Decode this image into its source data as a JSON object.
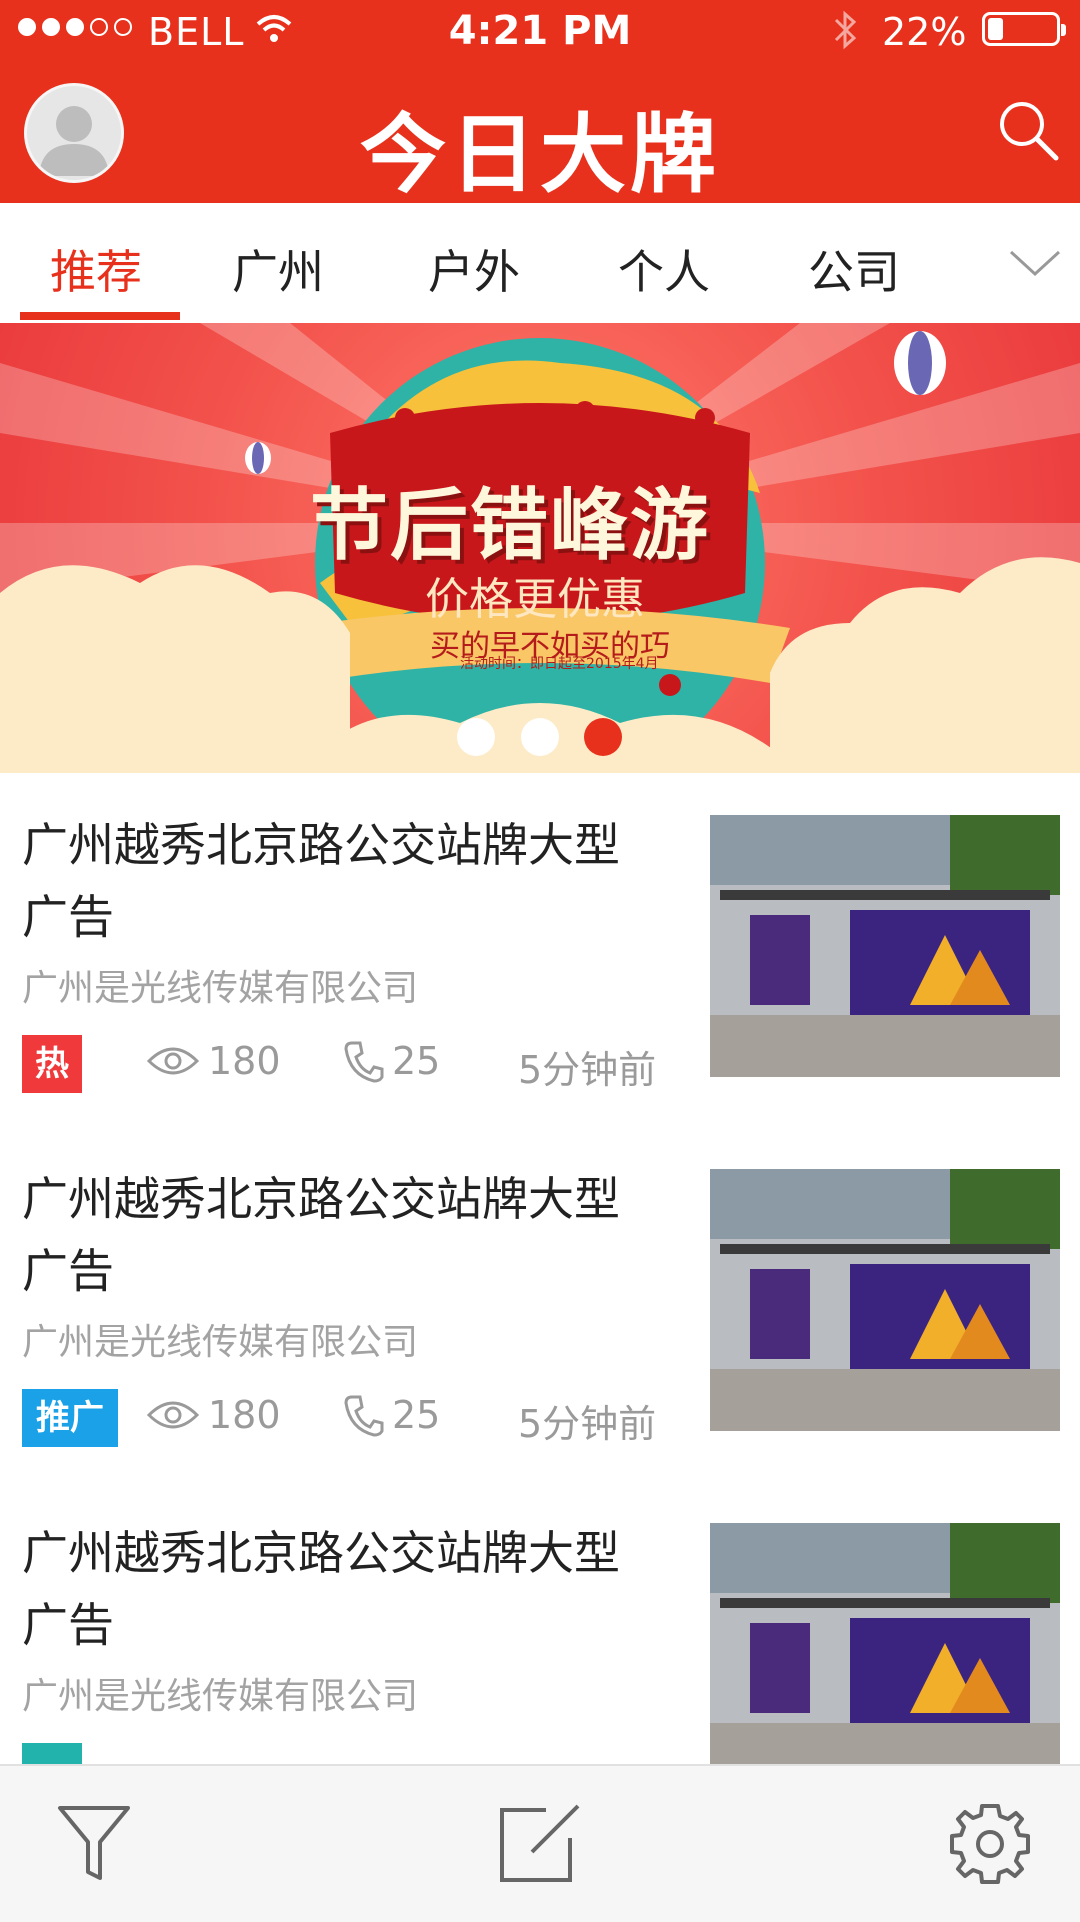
{
  "status": {
    "carrier": "BELL",
    "time": "4:21 PM",
    "battery": "22%",
    "battery_level": 0.22
  },
  "header": {
    "logo": "今日大牌"
  },
  "tabs": [
    {
      "label": "推荐",
      "active": true
    },
    {
      "label": "广州",
      "active": false
    },
    {
      "label": "户外",
      "active": false
    },
    {
      "label": "个人",
      "active": false
    },
    {
      "label": "公司",
      "active": false
    }
  ],
  "banner": {
    "title": "节后错峰游",
    "subtitle": "价格更优惠",
    "tagline": "买的早不如买的巧",
    "period": "活动时间：即日起至2015年4月",
    "page_count": 3,
    "active_index": 2
  },
  "items": [
    {
      "title": "广州越秀北京路公交站牌大型广告",
      "company": "广州是光线传媒有限公司",
      "badge": "热",
      "badge_color": "#f0393a",
      "views": "180",
      "calls": "25",
      "time": "5分钟前"
    },
    {
      "title": "广州越秀北京路公交站牌大型广告",
      "company": "广州是光线传媒有限公司",
      "badge": "推广",
      "badge_color": "#1aa1e8",
      "views": "180",
      "calls": "25",
      "time": "5分钟前"
    },
    {
      "title": "广州越秀北京路公交站牌大型广告",
      "company": "广州是光线传媒有限公司",
      "badge": "",
      "badge_color": "#23b3ad",
      "views": "",
      "calls": "",
      "time": ""
    }
  ],
  "colors": {
    "brand": "#e8311c"
  },
  "bottom_bar": {
    "icons": [
      "filter-icon",
      "edit-icon",
      "settings-icon"
    ]
  }
}
